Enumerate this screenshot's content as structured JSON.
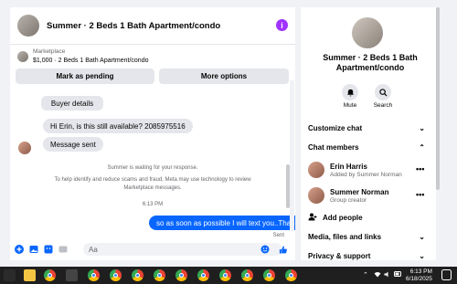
{
  "chat": {
    "title": "Summer · 2 Beds 1 Bath Apartment/condo",
    "info_glyph": "i",
    "marketplace_label": "Marketplace",
    "marketplace_item": "$1,000 · 2 Beds 1 Bath Apartment/condo",
    "mark_pending": "Mark as pending",
    "more_options": "More options",
    "buyer_details": "Buyer details",
    "msg_available": "Hi Erin, is this still available? 2085975516",
    "msg_sent_label": "Message sent",
    "system_waiting": "Summer is waiting for your response.",
    "system_safety": "To help identify and reduce scams and fraud, Meta may use technology to review Marketplace messages.",
    "timestamp": "6:13 PM",
    "outgoing": "so as soon as possible I will text you..Thanks",
    "sent_status": "Sent",
    "input_placeholder": "Aa"
  },
  "info": {
    "title": "Summer · 2 Beds 1 Bath Apartment/condo",
    "mute_label": "Mute",
    "search_label": "Search",
    "customize_chat": "Customize chat",
    "chat_members": "Chat members",
    "members": [
      {
        "name": "Erin Harris",
        "role": "Added by Summer Norman"
      },
      {
        "name": "Summer Norman",
        "role": "Group creator"
      }
    ],
    "add_people": "Add people",
    "media_files_links": "Media, files and links",
    "privacy_support": "Privacy & support"
  },
  "taskbar": {
    "time": "6:13 PM",
    "date": "6/18/2025"
  },
  "colors": {
    "accent": "#0866ff",
    "info_purple": "#a033ff",
    "panel_bg": "#ffffff",
    "page_bg": "#f0f2f5"
  }
}
